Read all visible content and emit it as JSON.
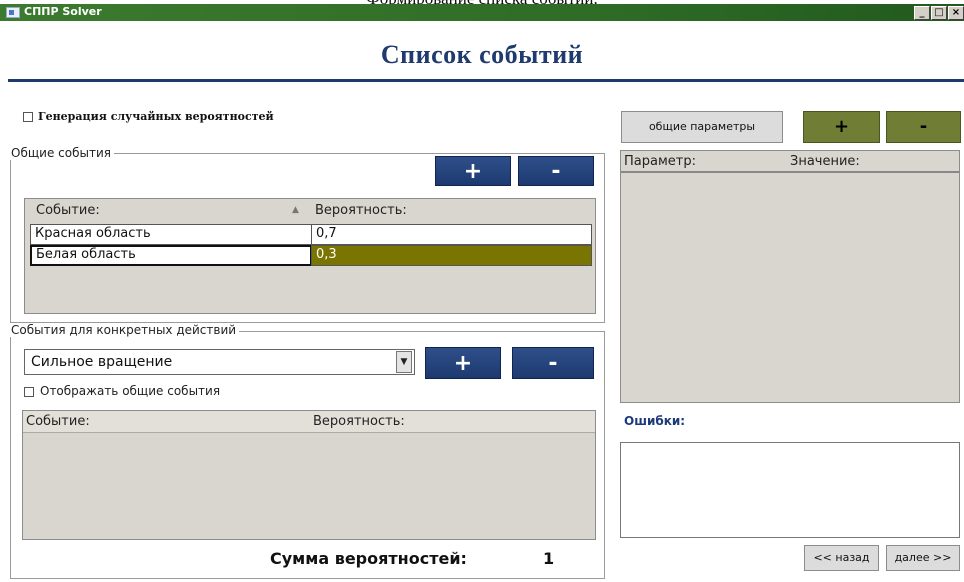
{
  "doc_caption": "Формирование списка событий.",
  "window": {
    "title": "СППР Solver",
    "min": "_",
    "max": "□",
    "close": "×"
  },
  "heading": "Список событий",
  "random_probabilities_label": "Генерация случайных вероятностей",
  "general_events": {
    "group_title": "Общие события",
    "add_label": "+",
    "remove_label": "-",
    "columns": {
      "event": "Событие:",
      "probability": "Вероятность:"
    },
    "rows": [
      {
        "event": "Красная область",
        "probability": "0,7"
      },
      {
        "event": "Белая область",
        "probability": "0,3"
      }
    ]
  },
  "action_events": {
    "group_title": "События для конкретных действий",
    "action_selected": "Сильное вращение",
    "add_label": "+",
    "remove_label": "-",
    "show_general_label": "Отображать общие события",
    "columns": {
      "event": "Событие:",
      "probability": "Вероятность:"
    }
  },
  "sum": {
    "label": "Сумма вероятностей:",
    "value": "1"
  },
  "parameters": {
    "general_button": "общие параметры",
    "add_label": "+",
    "remove_label": "-",
    "columns": {
      "param": "Параметр:",
      "value": "Значение:"
    }
  },
  "errors_label": "Ошибки:",
  "nav": {
    "back": "<< назад",
    "next": "далее >>"
  },
  "colors": {
    "accent": "#1f3a6e",
    "titlebar": "#2f6d27",
    "selection": "#7a7400",
    "olive": "#6f7d35"
  }
}
